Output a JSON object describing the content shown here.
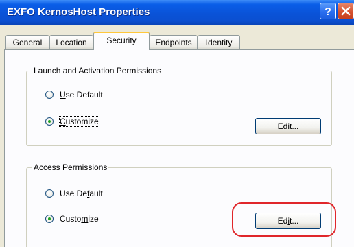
{
  "window": {
    "title": "EXFO KernosHost Properties",
    "help_button": "?",
    "close_button": "X"
  },
  "tabs": [
    {
      "label": "General"
    },
    {
      "label": "Location"
    },
    {
      "label": "Security",
      "active": true
    },
    {
      "label": "Endpoints"
    },
    {
      "label": "Identity"
    }
  ],
  "launch_group": {
    "title": "Launch and Activation Permissions",
    "use_default": {
      "pre": "",
      "mnemonic": "U",
      "post": "se Default"
    },
    "customize": {
      "pre": "",
      "mnemonic": "C",
      "post": "ustomize"
    },
    "edit": {
      "pre": "",
      "mnemonic": "E",
      "post": "dit..."
    },
    "selected": "Customize"
  },
  "access_group": {
    "title": "Access Permissions",
    "use_default": {
      "pre": "Use De",
      "mnemonic": "f",
      "post": "ault"
    },
    "customize": {
      "pre": "Custo",
      "mnemonic": "m",
      "post": "ize"
    },
    "edit": {
      "pre": "Ed",
      "mnemonic": "i",
      "post": "t..."
    },
    "selected": "Customize"
  },
  "colors": {
    "titlebar": "#0a53d8",
    "highlight": "#e0262a",
    "active_tab_accent": "#ffc83c"
  }
}
